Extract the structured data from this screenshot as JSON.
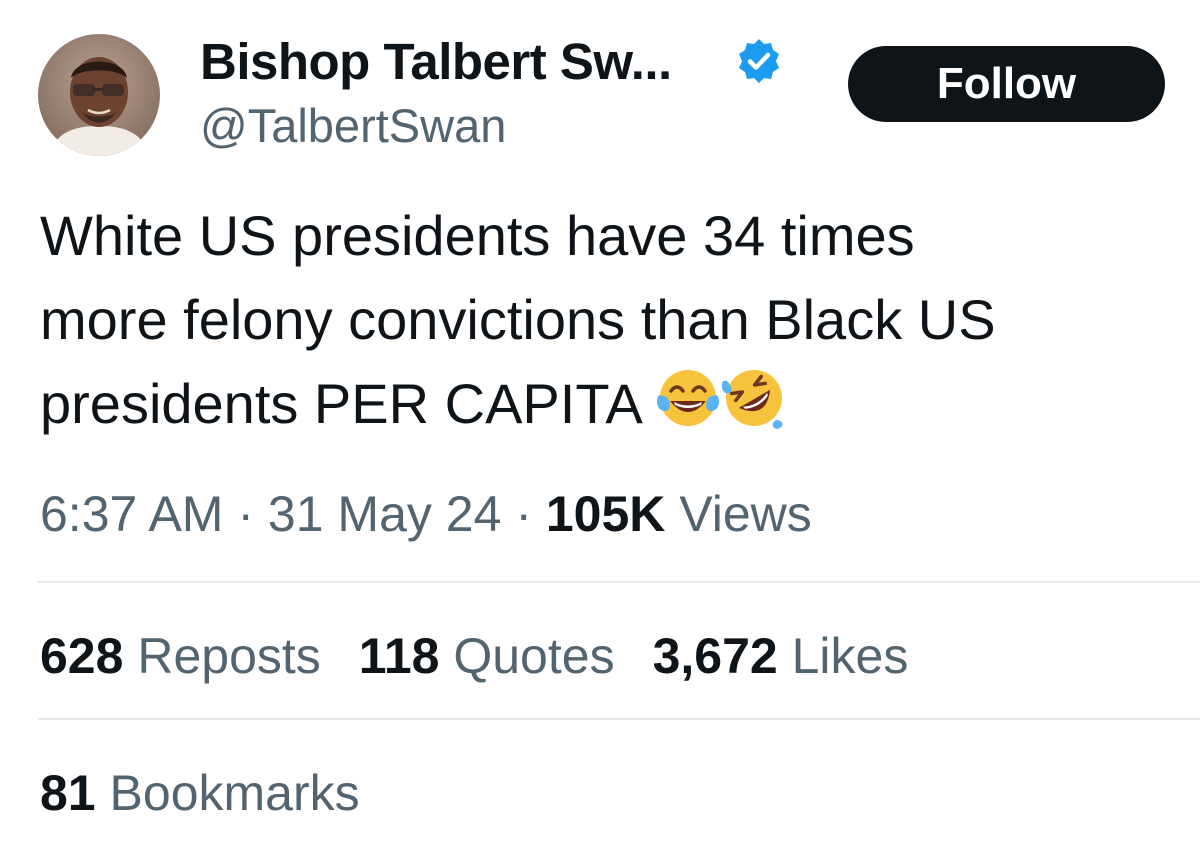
{
  "author": {
    "display_name": "Bishop Talbert Sw...",
    "handle": "@TalbertSwan",
    "verified_color": "#1d9bf0"
  },
  "follow_button": {
    "label": "Follow",
    "bg_color": "#0f1419",
    "text_color": "#ffffff"
  },
  "tweet": {
    "lines": [
      "White US presidents have 34 times",
      "more felony convictions than Black US",
      "presidents PER CAPITA"
    ],
    "emojis": [
      "face-with-tears-of-joy-icon",
      "rolling-on-the-floor-laughing-icon"
    ]
  },
  "meta": {
    "time": "6:37 AM",
    "separator": "·",
    "date": "31 May 24",
    "views_count": "105K",
    "views_label": "Views"
  },
  "stats": {
    "reposts_count": "628",
    "reposts_label": "Reposts",
    "quotes_count": "118",
    "quotes_label": "Quotes",
    "likes_count": "3,672",
    "likes_label": "Likes"
  },
  "bookmarks": {
    "count": "81",
    "label": "Bookmarks"
  }
}
